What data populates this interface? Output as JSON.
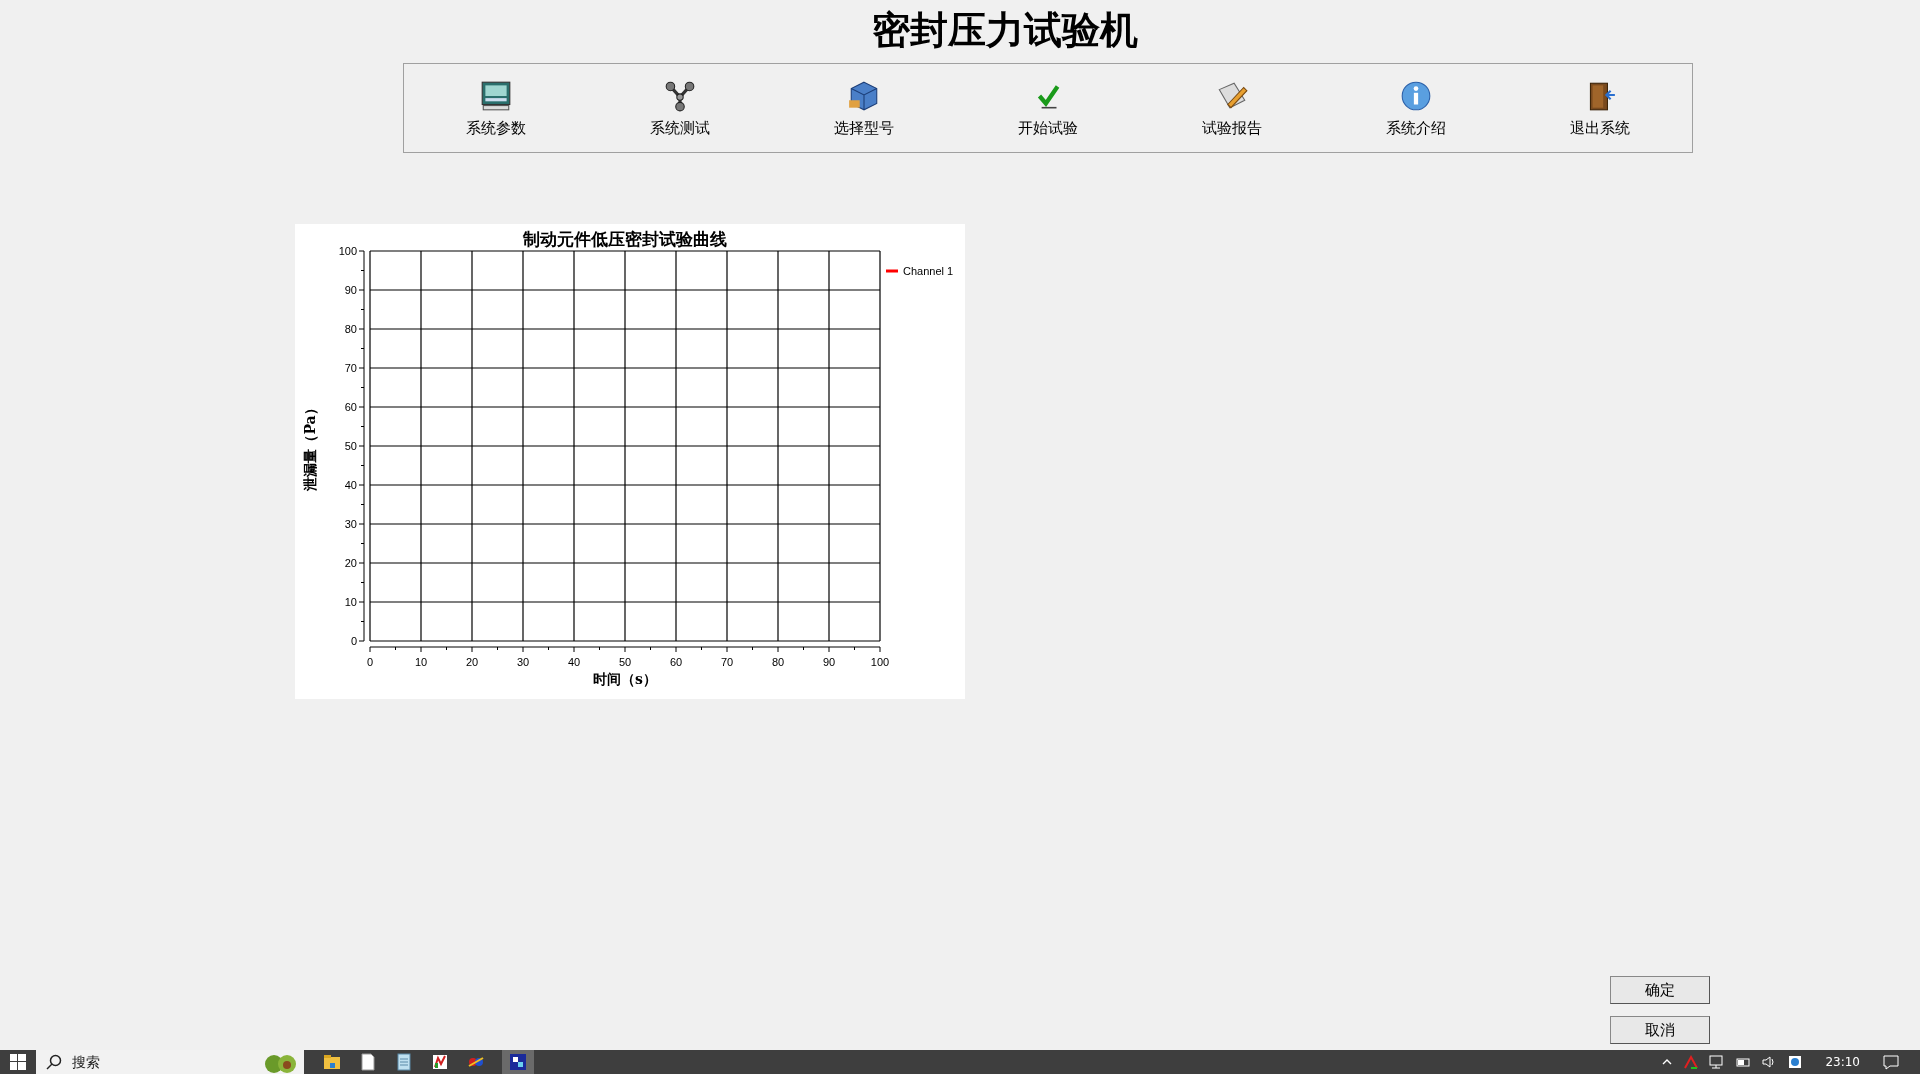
{
  "window": {
    "title": "密封压力试验机"
  },
  "toolbar": {
    "items": [
      {
        "label": "系统参数"
      },
      {
        "label": "系统测试"
      },
      {
        "label": "选择型号"
      },
      {
        "label": "开始试验"
      },
      {
        "label": "试验报告"
      },
      {
        "label": "系统介绍"
      },
      {
        "label": "退出系统"
      }
    ]
  },
  "chart": {
    "chart_data": {
      "type": "line",
      "title": "制动元件低压密封试验曲线",
      "xlabel": "时间（s）",
      "ylabel": "泄漏量（Pa）",
      "categories": [
        "0",
        "10",
        "20",
        "30",
        "40",
        "50",
        "60",
        "70",
        "80",
        "90",
        "100"
      ],
      "series": [
        {
          "name": "Channel 1",
          "color": "#ff0000",
          "values": [
            null,
            null,
            null,
            null,
            null,
            null,
            null,
            null,
            null,
            null,
            null
          ]
        }
      ],
      "grid": true,
      "ylim": [
        0,
        100
      ],
      "yticks": [
        0,
        10,
        20,
        30,
        40,
        50,
        60,
        70,
        80,
        90,
        100
      ]
    }
  },
  "buttons": [
    {
      "label": "确定"
    },
    {
      "label": "取消"
    }
  ],
  "taskbar": {
    "search": {
      "placeholder": "搜索"
    },
    "clock": "23:10"
  }
}
